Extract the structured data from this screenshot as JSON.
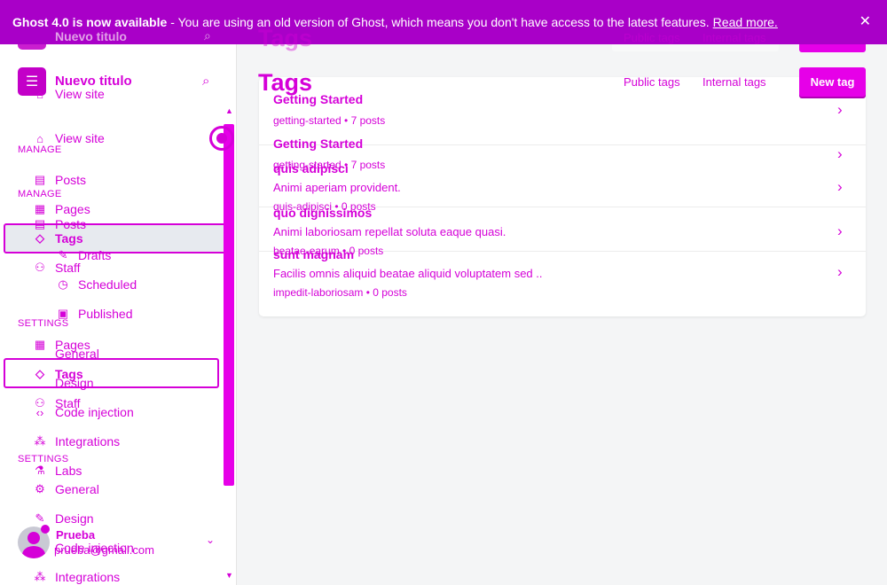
{
  "banner": {
    "bold": "Ghost 4.0 is now available",
    "text": "- You are using an old version of Ghost, which means you don't have access to the latest features.",
    "link": "Read more.",
    "close": "✕"
  },
  "sidebar": {
    "site_name": "Nuevo titulo",
    "view_site": "View site",
    "manage_label": "MANAGE",
    "settings_label": "SETTINGS",
    "items": {
      "posts": "Posts",
      "drafts": "Drafts",
      "scheduled": "Scheduled",
      "published": "Published",
      "pages": "Pages",
      "tags": "Tags",
      "staff": "Staff",
      "general": "General",
      "design": "Design",
      "code_injection": "Code injection",
      "integrations": "Integrations",
      "labs": "Labs"
    },
    "user": {
      "name": "Prueba",
      "email": "prueba@gmail.com"
    }
  },
  "header": {
    "title": "Tags",
    "tabs": [
      "Public tags",
      "Internal tags"
    ],
    "new_tag": "New tag"
  },
  "tags": [
    {
      "name": "Getting Started",
      "description": "",
      "meta": "getting-started • 7 posts"
    },
    {
      "name": "quis adipisci",
      "description": "Animi aperiam provident.",
      "meta": "quis-adipisci • 0 posts"
    },
    {
      "name": "quo dignissimos",
      "description": "Animi laboriosam repellat soluta eaque quasi.",
      "meta": "beatae-earum • 0 posts"
    },
    {
      "name": "sunt magnam",
      "description": "Facilis omnis aliquid beatae aliquid voluptatem sed ..",
      "meta": "impedit-laboriosam • 0 posts"
    }
  ],
  "colors": {
    "accent": "#d500d8",
    "banner": "#a900c8",
    "button": "#e600e8"
  },
  "icons": {
    "search": "search-icon",
    "close": "close-icon",
    "chevron": "chevron-right-icon"
  }
}
